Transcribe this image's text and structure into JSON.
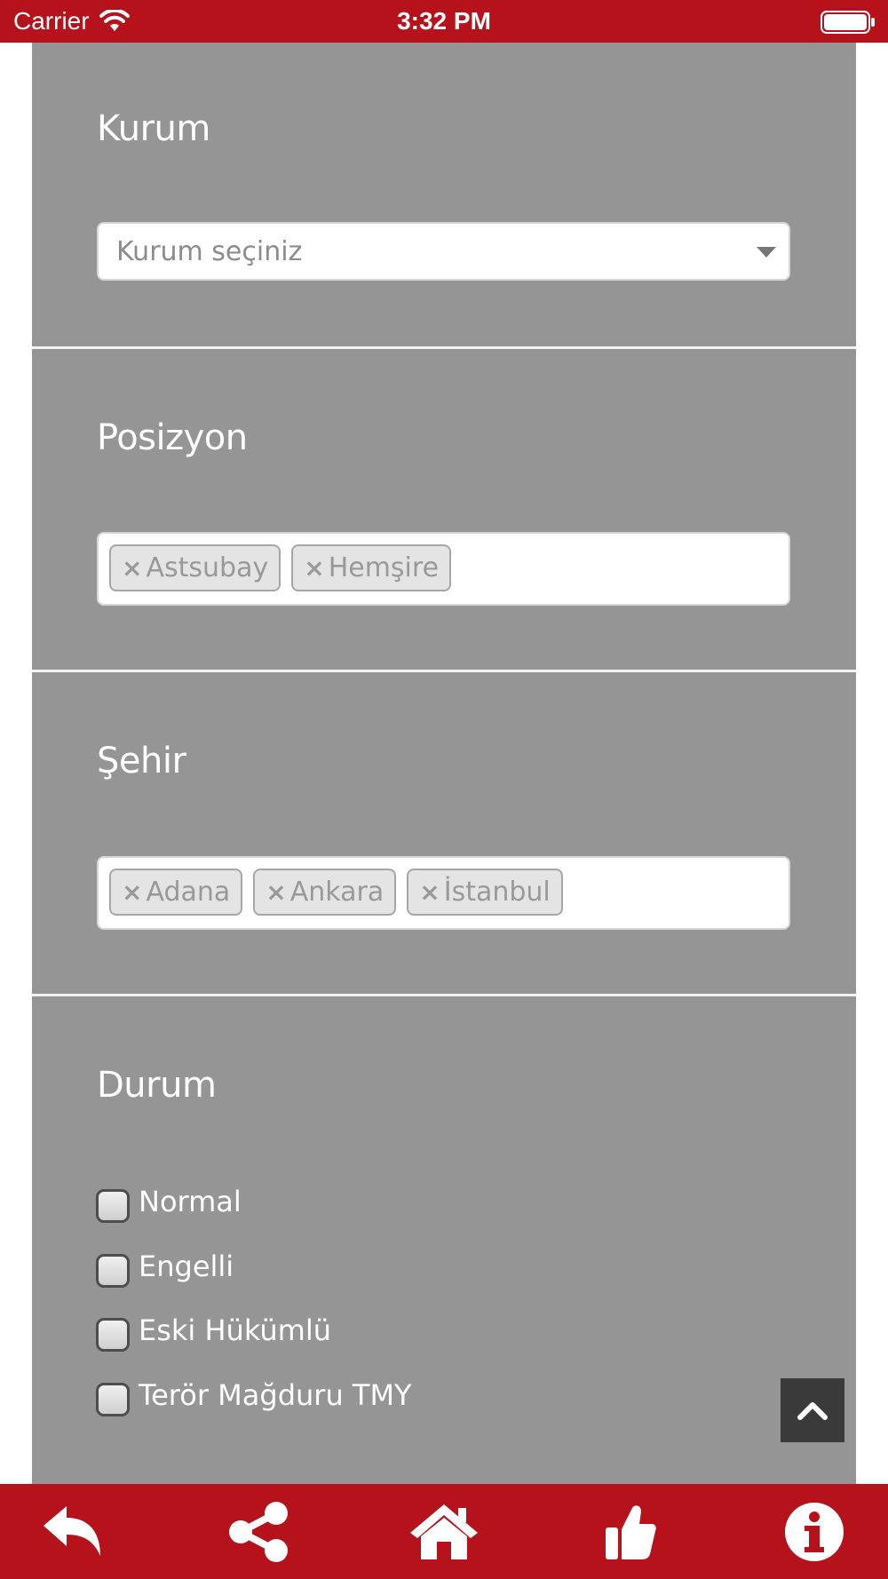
{
  "status_bar": {
    "carrier": "Carrier",
    "time": "3:32 PM",
    "icons": [
      "wifi-icon",
      "battery-icon"
    ]
  },
  "form": {
    "kurum": {
      "title": "Kurum",
      "placeholder": "Kurum seçiniz"
    },
    "posizyon": {
      "title": "Posizyon",
      "tags": [
        "Astsubay",
        "Hemşire"
      ]
    },
    "sehir": {
      "title": "Şehir",
      "tags": [
        "Adana",
        "Ankara",
        "İstanbul"
      ]
    },
    "durum": {
      "title": "Durum",
      "options": [
        {
          "label": "Normal",
          "checked": false
        },
        {
          "label": "Engelli",
          "checked": false
        },
        {
          "label": "Eski Hükümlü",
          "checked": false
        },
        {
          "label": "Terör Mağduru TMY",
          "checked": false
        }
      ]
    },
    "tag_remove_symbol": "×"
  },
  "scroll_top": {
    "icon": "chevron-up-icon"
  },
  "tab_bar": {
    "items": [
      "back-icon",
      "share-icon",
      "home-icon",
      "thumbs-up-icon",
      "info-icon"
    ]
  },
  "colors": {
    "brand_red": "#b5121b",
    "panel_gray": "#959595",
    "scroll_button": "#3a3a3a"
  }
}
